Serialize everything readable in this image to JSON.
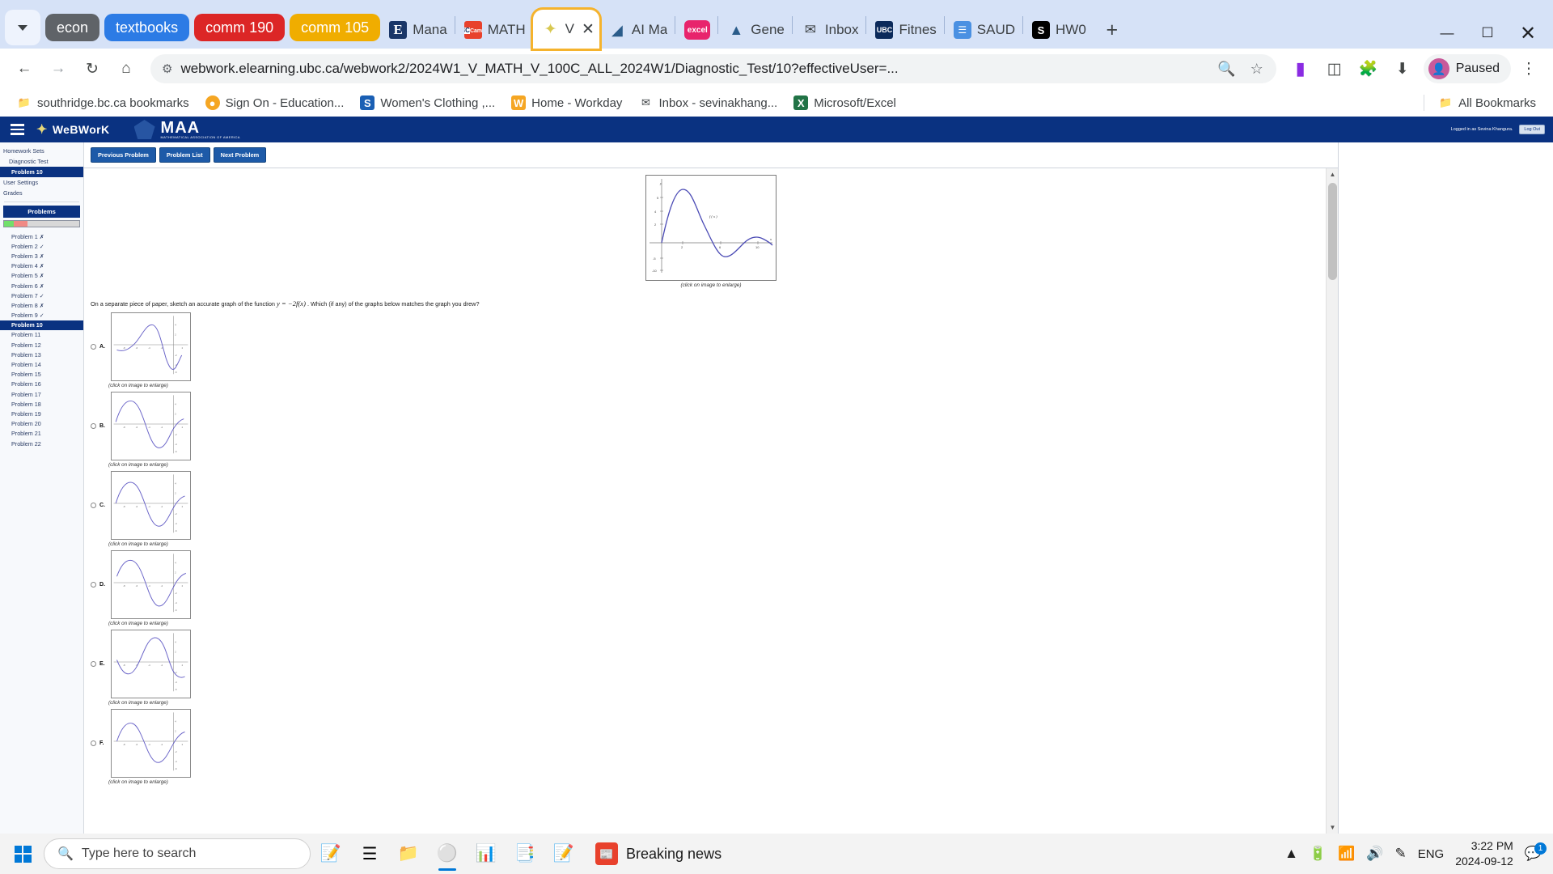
{
  "browser": {
    "tab_group_chips": [
      {
        "label": "econ",
        "color": "#5f6368"
      },
      {
        "label": "textbooks",
        "color": "#2c7be5"
      },
      {
        "label": "comm 190",
        "color": "#dc2626"
      },
      {
        "label": "comm 105",
        "color": "#f0ad00"
      }
    ],
    "tabs": [
      {
        "title": "Mana",
        "icon": "britannica-icon",
        "active": false
      },
      {
        "title": "MATH",
        "icon": "ubc-canvas-icon",
        "active": false
      },
      {
        "title": "V",
        "icon": "webwork-star-icon",
        "active": true
      },
      {
        "title": "AI Ma",
        "icon": "compass-icon",
        "active": false
      },
      {
        "title": "excel",
        "icon": "excel-pink-icon",
        "active": false
      },
      {
        "title": "Gene",
        "icon": "sauder-icon",
        "active": false
      },
      {
        "title": "Inbox",
        "icon": "gmail-icon",
        "active": false
      },
      {
        "title": "Fitnes",
        "icon": "ubc-navy-icon",
        "active": false
      },
      {
        "title": "SAUD",
        "icon": "document-blue-icon",
        "active": false
      },
      {
        "title": "HW0",
        "icon": "black-s-icon",
        "active": false
      }
    ],
    "new_tab_label": "+",
    "window_controls": {
      "minimize": "—",
      "maximize": "☐",
      "close": "✕"
    },
    "nav": {
      "back": "←",
      "forward": "→",
      "reload": "↻",
      "home": "⌂"
    },
    "omnibox": {
      "url": "webwork.elearning.ubc.ca/webwork2/2024W1_V_MATH_V_100C_ALL_2024W1/Diagnostic_Test/10?effectiveUser=...",
      "site_info_icon": "site-settings-icon",
      "zoom_icon": "zoom-icon",
      "bookmark_icon": "star-icon"
    },
    "toolbar_icons": [
      "extension-purple-icon",
      "split-screen-icon",
      "extensions-icon",
      "downloads-icon"
    ],
    "profile": {
      "label": "Paused",
      "avatar_icon": "person-icon"
    },
    "menu_icon": "kebab-menu-icon",
    "bookmarks": [
      {
        "label": "southridge.bc.ca bookmarks",
        "icon": "folder-gear-icon"
      },
      {
        "label": "Sign On - Education...",
        "icon": "orange-circle-icon"
      },
      {
        "label": "Women's Clothing ,...",
        "icon": "letter-s-icon"
      },
      {
        "label": "Home - Workday",
        "icon": "workday-w-icon"
      },
      {
        "label": "Inbox - sevinakhang...",
        "icon": "gmail-icon"
      },
      {
        "label": "Microsoft/Excel",
        "icon": "excel-icon"
      }
    ],
    "all_bookmarks": {
      "label": "All Bookmarks",
      "icon": "folder-icon"
    }
  },
  "webwork": {
    "brand": "WeBWorK",
    "maa_title": "MAA",
    "maa_subtitle": "MATHEMATICAL ASSOCIATION OF AMERICA",
    "logged_in_text": "Logged in as Sevina Khangura.",
    "logout_label": "Log Out",
    "menu_icon": "hamburger-icon",
    "nav_buttons": [
      {
        "label": "Previous Problem"
      },
      {
        "label": "Problem List"
      },
      {
        "label": "Next Problem"
      }
    ],
    "sidebar": {
      "links": [
        {
          "label": "Homework Sets",
          "level": 0,
          "active": false
        },
        {
          "label": "Diagnostic Test",
          "level": 1,
          "active": false
        },
        {
          "label": "Problem 10",
          "level": 2,
          "active": true
        },
        {
          "label": "User Settings",
          "level": 0,
          "active": false
        },
        {
          "label": "Grades",
          "level": 0,
          "active": false
        }
      ],
      "problems_header": "Problems",
      "progress": {
        "correct_pct": 13,
        "incorrect_pct": 18,
        "unattempted_pct": 69
      },
      "problems": [
        {
          "label": "Problem 1",
          "status": "✗",
          "active": false
        },
        {
          "label": "Problem 2",
          "status": "✓",
          "active": false
        },
        {
          "label": "Problem 3",
          "status": "✗",
          "active": false
        },
        {
          "label": "Problem 4",
          "status": "✗",
          "active": false
        },
        {
          "label": "Problem 5",
          "status": "✗",
          "active": false
        },
        {
          "label": "Problem 6",
          "status": "✗",
          "active": false
        },
        {
          "label": "Problem 7",
          "status": "✓",
          "active": false
        },
        {
          "label": "Problem 8",
          "status": "✗",
          "active": false
        },
        {
          "label": "Problem 9",
          "status": "✓",
          "active": false
        },
        {
          "label": "Problem 10",
          "status": "",
          "active": true
        },
        {
          "label": "Problem 11",
          "status": "",
          "active": false
        },
        {
          "label": "Problem 12",
          "status": "",
          "active": false
        },
        {
          "label": "Problem 13",
          "status": "",
          "active": false
        },
        {
          "label": "Problem 14",
          "status": "",
          "active": false
        },
        {
          "label": "Problem 15",
          "status": "",
          "active": false
        },
        {
          "label": "Problem 16",
          "status": "",
          "active": false
        },
        {
          "label": "Problem 17",
          "status": "",
          "active": false
        },
        {
          "label": "Problem 18",
          "status": "",
          "active": false
        },
        {
          "label": "Problem 19",
          "status": "",
          "active": false
        },
        {
          "label": "Problem 20",
          "status": "",
          "active": false
        },
        {
          "label": "Problem 21",
          "status": "",
          "active": false
        },
        {
          "label": "Problem 22",
          "status": "",
          "active": false
        }
      ]
    },
    "problem": {
      "question_pre": "On a separate piece of paper, sketch an accurate graph of the function ",
      "question_math": "y = −2f(x)",
      "question_post": " . Which (if any) of the graphs below matches the graph you drew?",
      "main_graph_caption": "(click on image to enlarge)",
      "main_graph_label": "f(x)",
      "choice_caption": "(click on image to enlarge)",
      "choices": [
        {
          "letter": "A."
        },
        {
          "letter": "B."
        },
        {
          "letter": "C."
        },
        {
          "letter": "D."
        },
        {
          "letter": "E."
        },
        {
          "letter": "F."
        }
      ]
    }
  },
  "chart_data": {
    "type": "line",
    "title": "f(x)",
    "xlabel": "x",
    "ylabel": "y",
    "main_graph": {
      "xlim": [
        -2,
        12
      ],
      "ylim": [
        -12,
        10
      ],
      "yticks": [
        -10,
        -5,
        5
      ],
      "xticks": [
        2,
        6,
        10
      ],
      "curve_label": "f(x)",
      "color": "#4b4bb5",
      "points": [
        {
          "x": 0,
          "y": 0
        },
        {
          "x": 1,
          "y": 5
        },
        {
          "x": 2,
          "y": 8
        },
        {
          "x": 3,
          "y": 6
        },
        {
          "x": 4,
          "y": 2
        },
        {
          "x": 5,
          "y": -3
        },
        {
          "x": 6,
          "y": -7
        },
        {
          "x": 7,
          "y": -8
        },
        {
          "x": 8,
          "y": -6
        },
        {
          "x": 9,
          "y": -3
        },
        {
          "x": 10,
          "y": -1
        },
        {
          "x": 11,
          "y": -1.5
        }
      ]
    },
    "options": [
      {
        "letter": "A.",
        "description": "Reflected and stretched curve, trough at right",
        "color": "#6a64c8"
      },
      {
        "letter": "B.",
        "description": "Peak at left, deep trough in middle",
        "color": "#6a64c8"
      },
      {
        "letter": "C.",
        "description": "Peak left, trough right of axis",
        "color": "#6a64c8"
      },
      {
        "letter": "D.",
        "description": "Rising peak then deep drop",
        "color": "#6a64c8"
      },
      {
        "letter": "E.",
        "description": "Trough then tall peak",
        "color": "#6a64c8"
      },
      {
        "letter": "F.",
        "description": "Peak then trough then rise",
        "color": "#6a64c8"
      }
    ]
  },
  "taskbar": {
    "start_icon": "windows-icon",
    "search_placeholder": "Type here to search",
    "search_icon": "search-icon",
    "icons": [
      {
        "name": "snip-sketch-icon"
      },
      {
        "name": "task-view-icon"
      },
      {
        "name": "file-explorer-icon"
      },
      {
        "name": "chrome-icon"
      },
      {
        "name": "excel-icon"
      },
      {
        "name": "onenote-icon"
      },
      {
        "name": "sticky-notes-icon"
      }
    ],
    "news": {
      "label": "Breaking news",
      "icon": "news-icon"
    },
    "tray": {
      "chevron": "show-hidden-icons",
      "battery": "battery-icon",
      "wifi": "wifi-icon",
      "volume": "volume-icon",
      "pen": "pen-icon",
      "language": "ENG"
    },
    "clock": {
      "time": "3:22 PM",
      "date": "2024-09-12"
    },
    "notification_count": "1"
  }
}
